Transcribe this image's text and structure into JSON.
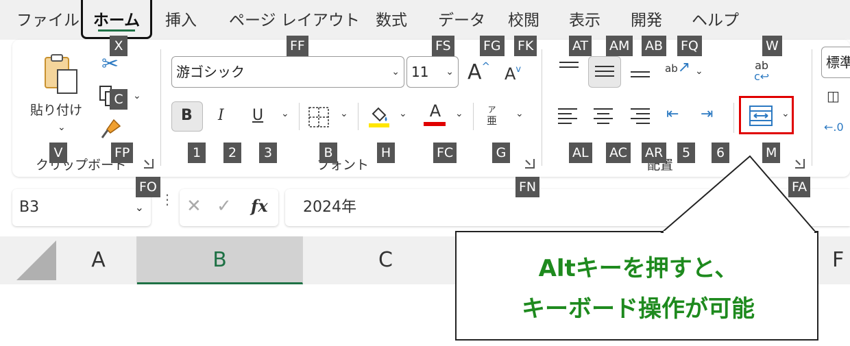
{
  "tabs": [
    "ファイル",
    "ホーム",
    "挿入",
    "ページ レイアウト",
    "数式",
    "データ",
    "校閲",
    "表示",
    "開発",
    "ヘルプ"
  ],
  "groups": {
    "clipboard": "クリップボード",
    "font": "フォント",
    "alignment": "配置"
  },
  "clipboard": {
    "paste_label": "貼り付け"
  },
  "font": {
    "name": "游ゴシック",
    "size": "11",
    "bold": "B",
    "italic": "I",
    "underline": "U",
    "font_color": "A",
    "phonetic_top": "ア",
    "phonetic_bottom": "亜"
  },
  "number": {
    "format_partial": "標準"
  },
  "keytips": {
    "X": "X",
    "C": "C",
    "V": "V",
    "FP": "FP",
    "FO": "FO",
    "FF": "FF",
    "FS": "FS",
    "FG": "FG",
    "FK": "FK",
    "k1": "1",
    "k2": "2",
    "k3": "3",
    "B": "B",
    "H": "H",
    "FC": "FC",
    "G": "G",
    "FN": "FN",
    "AT": "AT",
    "AM": "AM",
    "AB": "AB",
    "FQ": "FQ",
    "W": "W",
    "AL": "AL",
    "AC": "AC",
    "AR": "AR",
    "k5": "5",
    "k6": "6",
    "M": "M",
    "FA": "FA"
  },
  "formula_bar": {
    "name_box": "B3",
    "formula": "2024年",
    "fx": "fx"
  },
  "columns": [
    "A",
    "B",
    "C",
    "F"
  ],
  "selected_column": "B",
  "callout": {
    "line1": "Altキーを押すと、",
    "line2": "キーボード操作が可能"
  },
  "colors": {
    "accent_green": "#1e7145",
    "keytip_bg": "#555555",
    "highlight_red": "#e00000",
    "callout_text": "#1e8a1e"
  },
  "icons": [
    "paste-icon",
    "cut-icon",
    "copy-icon",
    "format-painter-icon",
    "grow-font-icon",
    "shrink-font-icon",
    "border-icon",
    "fill-color-icon",
    "font-color-icon",
    "phonetic-icon",
    "align-top-icon",
    "align-middle-icon",
    "align-bottom-icon",
    "orientation-icon",
    "wrap-text-icon",
    "align-left-icon",
    "align-center-icon",
    "align-right-icon",
    "decrease-indent-icon",
    "increase-indent-icon",
    "merge-center-icon",
    "cancel-icon",
    "enter-icon"
  ]
}
